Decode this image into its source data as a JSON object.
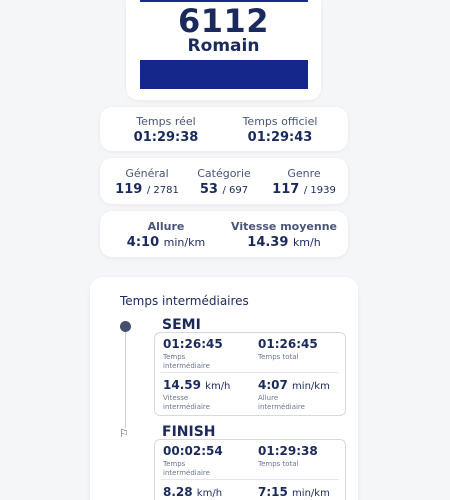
{
  "bib": {
    "number": "6112",
    "name": "Romain"
  },
  "times": {
    "real_label": "Temps réel",
    "real_value": "01:29:38",
    "official_label": "Temps officiel",
    "official_value": "01:29:43"
  },
  "rankings": {
    "general_label": "Général",
    "general_rank": "119",
    "general_total": "/ 2781",
    "category_label": "Catégorie",
    "category_rank": "53",
    "category_total": "/ 697",
    "gender_label": "Genre",
    "gender_rank": "117",
    "gender_total": "/ 1939"
  },
  "pace": {
    "pace_label": "Allure",
    "pace_value": "4:10",
    "pace_unit": "min/km",
    "speed_label": "Vitesse moyenne",
    "speed_value": "14.39",
    "speed_unit": "km/h"
  },
  "splits": {
    "title": "Temps intermédiaires",
    "items": [
      {
        "name": "SEMI",
        "split_time": "01:26:45",
        "split_time_label_1": "Temps",
        "split_time_label_2": "intermédiaire",
        "total_time": "01:26:45",
        "total_time_label": "Temps total",
        "speed": "14.59",
        "speed_unit": "km/h",
        "speed_label_1": "Vitesse",
        "speed_label_2": "intermédiaire",
        "pace": "4:07",
        "pace_unit": "min/km",
        "pace_label_1": "Allure",
        "pace_label_2": "intermédiaire"
      },
      {
        "name": "FINISH",
        "split_time": "00:02:54",
        "split_time_label_1": "Temps",
        "split_time_label_2": "intermédiaire",
        "total_time": "01:29:38",
        "total_time_label": "Temps total",
        "speed": "8.28",
        "speed_unit": "km/h",
        "pace": "7:15",
        "pace_unit": "min/km"
      }
    ]
  },
  "icons": {
    "checkpoint": "dot-icon",
    "finish": "flag-icon"
  }
}
